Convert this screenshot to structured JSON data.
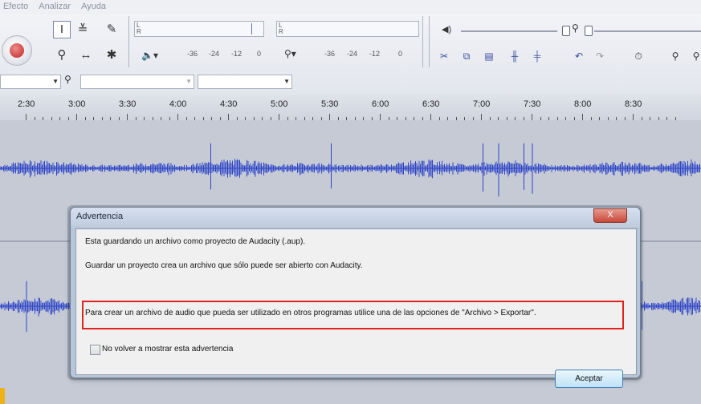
{
  "menu": [
    "Efecto",
    "Analizar",
    "Ayuda"
  ],
  "meters": {
    "playback_scale": [
      "-36",
      "-24",
      "-12",
      "0"
    ],
    "record_scale": [
      "-36",
      "-24",
      "-12",
      "0"
    ],
    "channel_l": "L",
    "channel_r": "R"
  },
  "timeline": [
    "2:30",
    "3:00",
    "3:30",
    "4:00",
    "4:30",
    "5:00",
    "5:30",
    "6:00",
    "6:30",
    "7:00",
    "7:30",
    "8:00",
    "8:30"
  ],
  "dialog": {
    "title": "Advertencia",
    "close_label": "X",
    "line1": "Esta guardando un archivo como proyecto de Audacity (.aup).",
    "line2": "Guardar un proyecto crea un archivo que sólo puede ser abierto con Audacity.",
    "line3": "Para crear un archivo de audio que pueda ser utilizado en otros programas utilice una de las opciones de \"Archivo > Exportar\".",
    "checkbox_label": "No volver a mostrar esta advertencia",
    "ok_label": "Aceptar"
  },
  "colors": {
    "waveform": "#2f45c8",
    "highlight": "#e0241d",
    "record": "#c02424"
  }
}
